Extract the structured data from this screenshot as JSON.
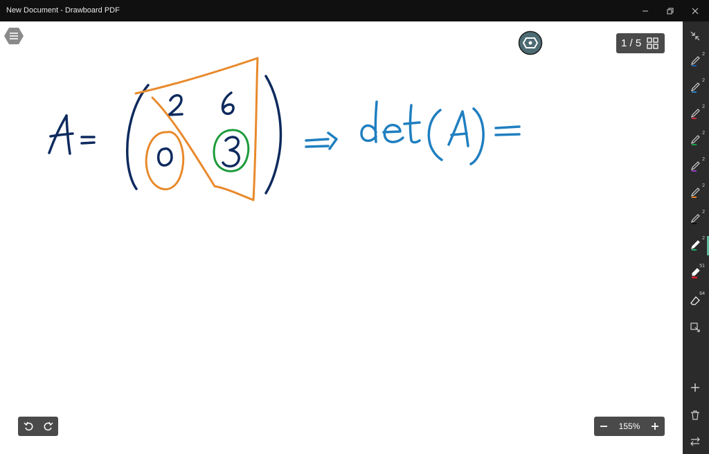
{
  "window": {
    "title": "New Document - Drawboard PDF"
  },
  "page_indicator": {
    "text": "1 / 5"
  },
  "zoom": {
    "value": "155%"
  },
  "ink": {
    "lhs": "A=",
    "matrix": {
      "a11": "2",
      "a12": "6",
      "a21": "0",
      "a22": "3"
    },
    "rhs": "=> det(A) ="
  },
  "toolbar": {
    "tools": [
      {
        "name": "pen-1",
        "color": "#1e5fa8",
        "count": "2"
      },
      {
        "name": "pen-2",
        "color": "#2c7fc2",
        "count": "2"
      },
      {
        "name": "pen-3",
        "color": "#d12b3b",
        "count": "2"
      },
      {
        "name": "pen-4",
        "color": "#16a34a",
        "count": "2"
      },
      {
        "name": "pen-5",
        "color": "#9b3fc9",
        "count": "2"
      },
      {
        "name": "pen-6",
        "color": "#e8821e",
        "count": "2"
      },
      {
        "name": "pen-7",
        "color": "#111111",
        "count": "2"
      },
      {
        "name": "pen-8",
        "color": "#1db36b",
        "count": "2"
      },
      {
        "name": "highlighter",
        "color": "#e11d2a",
        "count": "51"
      },
      {
        "name": "eraser",
        "color": "#ffffff",
        "count": "64"
      }
    ]
  },
  "colors": {
    "ink_navy": "#0e2a5e",
    "ink_blue": "#1f7fc0",
    "ink_orange": "#e8892b",
    "ink_green": "#1c9b3a"
  }
}
